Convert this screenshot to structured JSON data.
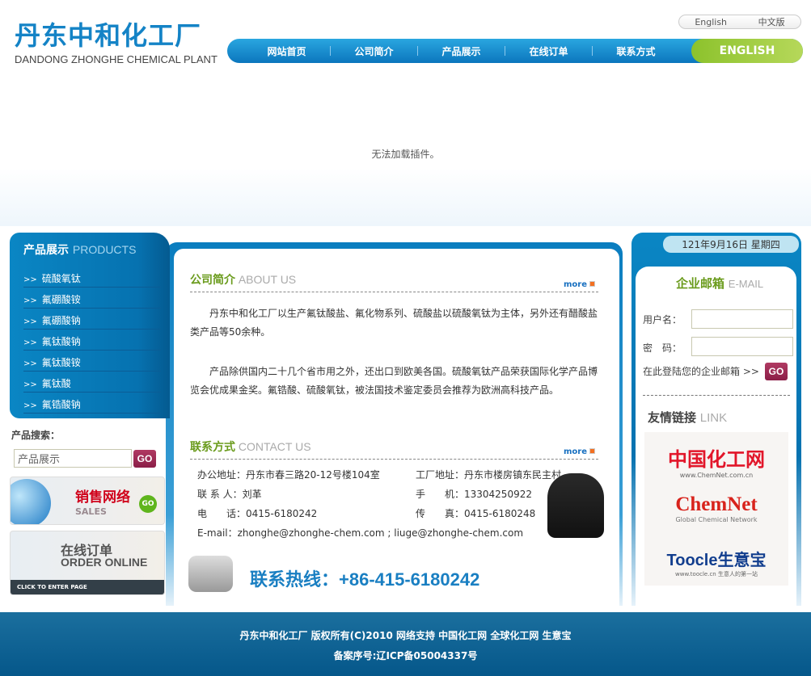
{
  "header": {
    "logo_cn": "丹东中和化工厂",
    "logo_en": "DANDONG ZHONGHE CHEMICAL PLANT",
    "lang": [
      "English",
      "中文版"
    ],
    "nav": [
      "网站首页",
      "公司简介",
      "产品展示",
      "在线订单",
      "联系方式"
    ],
    "nav_english": "ENGLISH"
  },
  "plugin_message": "无法加载插件。",
  "products": {
    "title": "产品展示",
    "title_en": "PRODUCTS",
    "bullet": ">>",
    "items": [
      "硫酸氧钛",
      "氟硼酸铵",
      "氟硼酸钠",
      "氟钛酸钠",
      "氟钛酸铵",
      "氟钛酸",
      "氟锆酸钠"
    ]
  },
  "search": {
    "label": "产品搜索：",
    "value": "产品展示",
    "go": "GO"
  },
  "banners": {
    "sales_cn": "销售网络",
    "sales_en": "SALES",
    "sales_go": "GO",
    "order_cn": "在线订单",
    "order_en": "ORDER ONLINE",
    "order_click": "CLICK TO ENTER PAGE"
  },
  "about": {
    "title": "公司简介",
    "title_en": "ABOUT US",
    "more": "more",
    "paragraphs": [
      "丹东中和化工厂以生产氟钛酸盐、氟化物系列、硫酸盐以硫酸氧钛为主体，另外还有醋酸盐类产品等50余种。",
      "产品除供国内二十几个省市用之外，还出口到欧美各国。硫酸氧钛产品荣获国际化学产品博览会优成果金奖。氟锆酸、硫酸氧钛，被法国技术鉴定委员会推荐为欧洲高科技产品。"
    ]
  },
  "contact": {
    "title": "联系方式",
    "title_en": "CONTACT US",
    "more": "more",
    "office": "办公地址：丹东市春三路20-12号楼104室",
    "factory": "工厂地址：丹东市楼房镇东民主村",
    "person": "联 系 人：刘革",
    "mobile": "手　　机：13304250922",
    "phone": "电　　话：0415-6180242",
    "fax": "传　　真：0415-6180248",
    "email": "E-mail：zhonghe@zhonghe-chem.com ; liuge@zhonghe-chem.com",
    "hotline": "联系热线：+86-415-6180242"
  },
  "right": {
    "date": "121年9月16日 星期四",
    "mail_title": "企业邮箱",
    "mail_title_en": "E-MAIL",
    "username_label": "用户名：",
    "password_label": "密　码：",
    "login_text": "在此登陆您的企业邮箱 >>",
    "go": "GO",
    "links_title": "友情链接",
    "links_title_en": "LINK",
    "links": [
      {
        "name": "中国化工网",
        "sub": "www.ChemNet.com.cn"
      },
      {
        "name": "ChemNet",
        "sub": "Global Chemical Network"
      },
      {
        "name": "Toocle生意宝",
        "sub": "www.toocle.cn 生意人的第一站"
      }
    ]
  },
  "footer": {
    "line1": "丹东中和化工厂 版权所有(C)2010 网络支持 中国化工网 全球化工网 生意宝",
    "line2": "备案序号:辽ICP备05004337号"
  },
  "colors": {
    "blue": "#0a7dbf",
    "green": "#6a9b1c",
    "go": "#9b2a53",
    "footer": "#0d6494"
  }
}
